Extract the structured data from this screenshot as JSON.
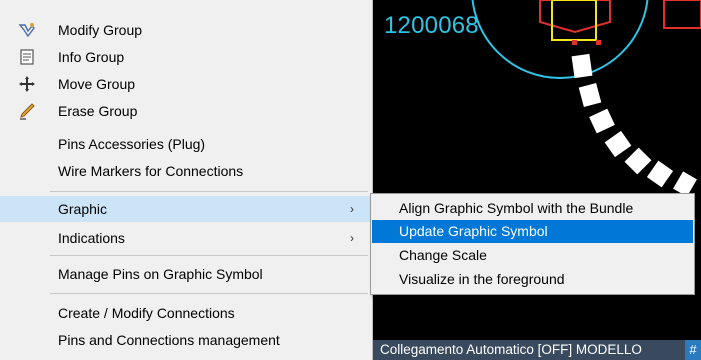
{
  "canvas": {
    "label": "1200068",
    "label_color": "#2ec4e6",
    "background": "#000000"
  },
  "status_bar": {
    "text": "Collegamento Automatico [OFF]  MODELLO",
    "grid_icon": "#"
  },
  "context_menu": {
    "items": [
      {
        "label": "Modify Group",
        "icon": "modify-group-icon"
      },
      {
        "label": "Info Group",
        "icon": "info-group-icon"
      },
      {
        "label": "Move Group",
        "icon": "move-group-icon"
      },
      {
        "label": "Erase Group",
        "icon": "erase-group-icon"
      },
      {
        "label": "Pins Accessories (Plug)",
        "icon": null
      },
      {
        "label": "Wire Markers for Connections",
        "icon": null
      },
      {
        "label": "Graphic",
        "icon": null,
        "submenu": true,
        "highlighted": true
      },
      {
        "label": "Indications",
        "icon": null,
        "submenu": true
      },
      {
        "label": "Manage Pins on Graphic Symbol",
        "icon": null
      },
      {
        "label": "Create / Modify Connections",
        "icon": null
      },
      {
        "label": "Pins and Connections management",
        "icon": null
      }
    ]
  },
  "graphic_submenu": {
    "items": [
      {
        "label": "Align Graphic Symbol with the Bundle"
      },
      {
        "label": "Update Graphic Symbol",
        "selected": true
      },
      {
        "label": "Change Scale"
      },
      {
        "label": "Visualize in the foreground"
      }
    ],
    "selection_color": "#0078d7"
  }
}
